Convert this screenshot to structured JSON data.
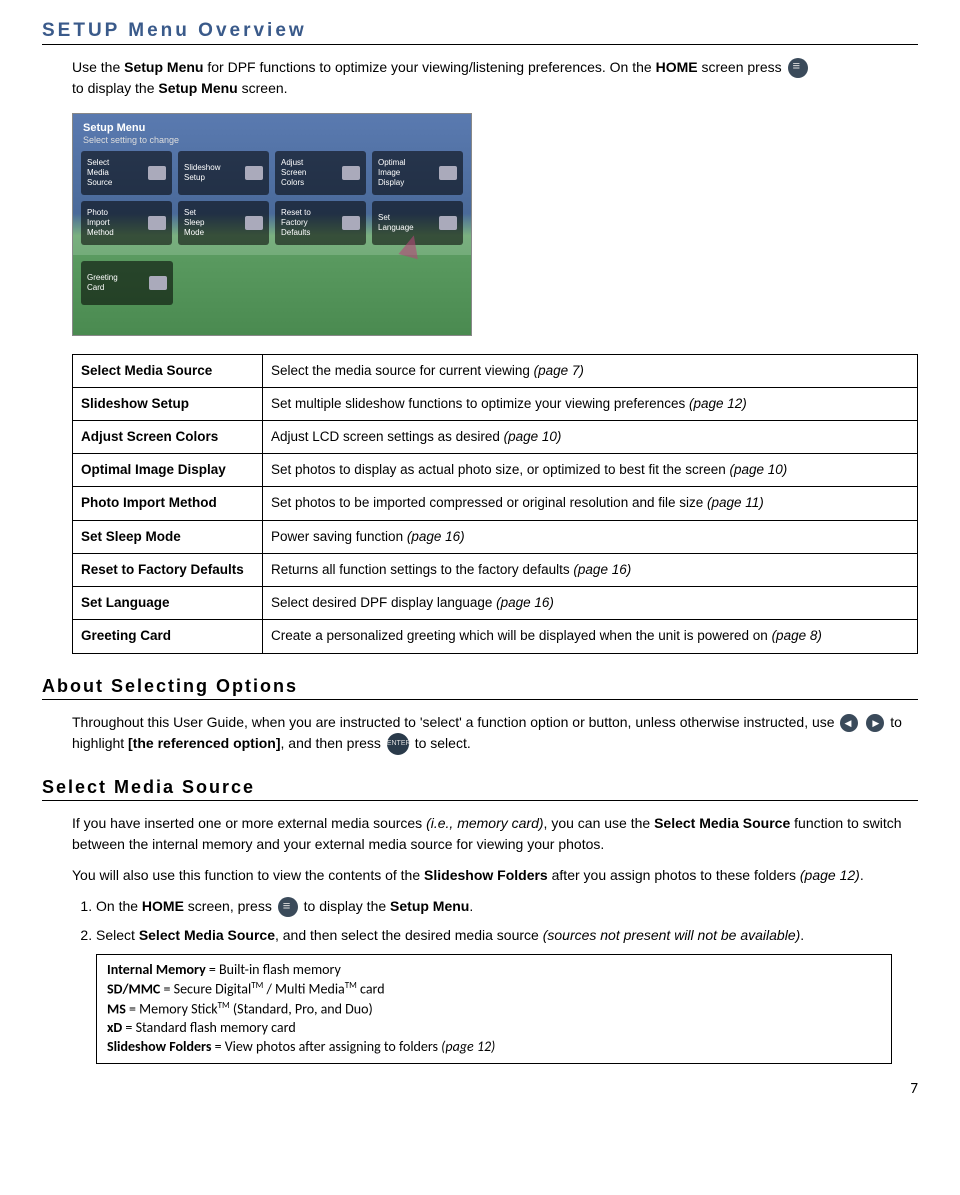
{
  "title": "SETUP Menu Overview",
  "intro": {
    "line1a": "Use the ",
    "setup_menu": "Setup Menu",
    "line1b": " for DPF functions to optimize your viewing/listening preferences. On the ",
    "home": "HOME",
    "line1c": " screen press ",
    "line2a": "to display the ",
    "setup_menu_screen": "Setup Menu",
    "line2b": " screen."
  },
  "screenshot": {
    "title": "Setup Menu",
    "subtitle": "Select setting to change",
    "row1": [
      "Select\nMedia\nSource",
      "Slideshow\nSetup",
      "Adjust\nScreen\nColors",
      "Optimal\nImage\nDisplay"
    ],
    "row2": [
      "Photo\nImport\nMethod",
      "Set\nSleep\nMode",
      "Reset to\nFactory\nDefaults",
      "Set\nLanguage"
    ],
    "row3": [
      "Greeting\nCard"
    ]
  },
  "table": [
    {
      "k": "Select Media Source",
      "v": "Select the media source for current viewing ",
      "pg": "(page 7)"
    },
    {
      "k": "Slideshow Setup",
      "v": "Set multiple slideshow functions to optimize your viewing preferences ",
      "pg": "(page 12)"
    },
    {
      "k": "Adjust Screen Colors",
      "v": "Adjust LCD screen settings as desired ",
      "pg": "(page 10)"
    },
    {
      "k": "Optimal Image Display",
      "v": "Set photos to display as actual photo size, or optimized to best fit the screen ",
      "pg": "(page 10)"
    },
    {
      "k": "Photo Import Method",
      "v": "Set photos to be imported compressed or original resolution and file size ",
      "pg": "(page 11)"
    },
    {
      "k": "Set Sleep Mode",
      "v": "Power saving function ",
      "pg": "(page 16)"
    },
    {
      "k": "Reset to Factory Defaults",
      "v": "Returns all function settings to the factory defaults ",
      "pg": "(page 16)"
    },
    {
      "k": "Set Language",
      "v": "Select desired DPF display language ",
      "pg": "(page 16)"
    },
    {
      "k": "Greeting Card",
      "v": "Create a personalized greeting which will be displayed when the unit is powered on ",
      "pg": "(page 8)"
    }
  ],
  "about": {
    "heading": "About Selecting Options",
    "p1a": "Throughout this User Guide, when you are instructed to 'select' a function option or button, unless otherwise instructed, use ",
    "p1b": " to highlight ",
    "ref": "[the referenced option]",
    "p1c": ", and then press ",
    "p1d": " to select."
  },
  "sms": {
    "heading": "Select Media Source",
    "p1a": "If you have inserted one or more external media sources ",
    "p1i": "(i.e., memory card)",
    "p1b": ", you can use the ",
    "sm": "Select Media Source",
    "p1c": " function to switch between the internal memory and your external media source for viewing your photos.",
    "p2a": "You will also use this function to view the contents of the ",
    "sf": "Slideshow Folders",
    "p2b": " after you assign photos to these folders ",
    "p2pg": "(page 12)",
    "p2c": ".",
    "li1a": "On the ",
    "home": "HOME",
    "li1b": " screen, press ",
    "li1c": " to display the ",
    "setup_menu": "Setup Menu",
    "li1d": ".",
    "li2a": "Select ",
    "sm2": "Select Media Source",
    "li2b": ", and then select the desired media source ",
    "li2i": "(sources not present will not be available)",
    "li2c": "."
  },
  "defs": {
    "l1a": "Internal Memory",
    "l1b": " = Built-in flash memory",
    "l2a": "SD/MMC",
    "l2b": " = Secure Digital",
    "tm": "TM",
    "l2c": " / Multi Media",
    "l2d": " card",
    "l3a": "MS",
    "l3b": " = Memory Stick",
    "l3c": " (Standard, Pro, and Duo)",
    "l4a": "xD",
    "l4b": " = Standard flash memory card",
    "l5a": "Slideshow Folders",
    "l5b": " = View photos after assigning to folders ",
    "l5pg": "(page 12)"
  },
  "page_number": "7"
}
